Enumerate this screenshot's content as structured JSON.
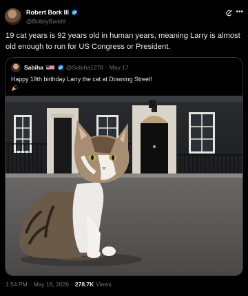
{
  "author": {
    "name": "Robert Bork III",
    "handle": "@BobbyBorkIII"
  },
  "tweet": {
    "text": "19 cat years is 92 years old in human years, meaning Larry is almost old enough to run for US Congress or President."
  },
  "quoted": {
    "name": "Sabiha",
    "handle": "@Sabiha1278",
    "separator": "·",
    "date": "May 17",
    "text": "Happy 19th birthday Larry the cat at Downing Street!"
  },
  "footer": {
    "time": "1:54 PM",
    "dot1": "·",
    "date": "May 18, 2026",
    "dot2": "·",
    "views_count": "278.7K",
    "views_label": "Views"
  },
  "icons": {
    "verified": "verified-badge-icon",
    "grok": "grok-icon",
    "more": "more-icon",
    "flag": "us-flag-icon",
    "party": "party-popper-icon"
  },
  "colors": {
    "background": "#000000",
    "text": "#e7e9ea",
    "secondary": "#71767b",
    "verified": "#1d9bf0",
    "border": "#2f3336"
  }
}
